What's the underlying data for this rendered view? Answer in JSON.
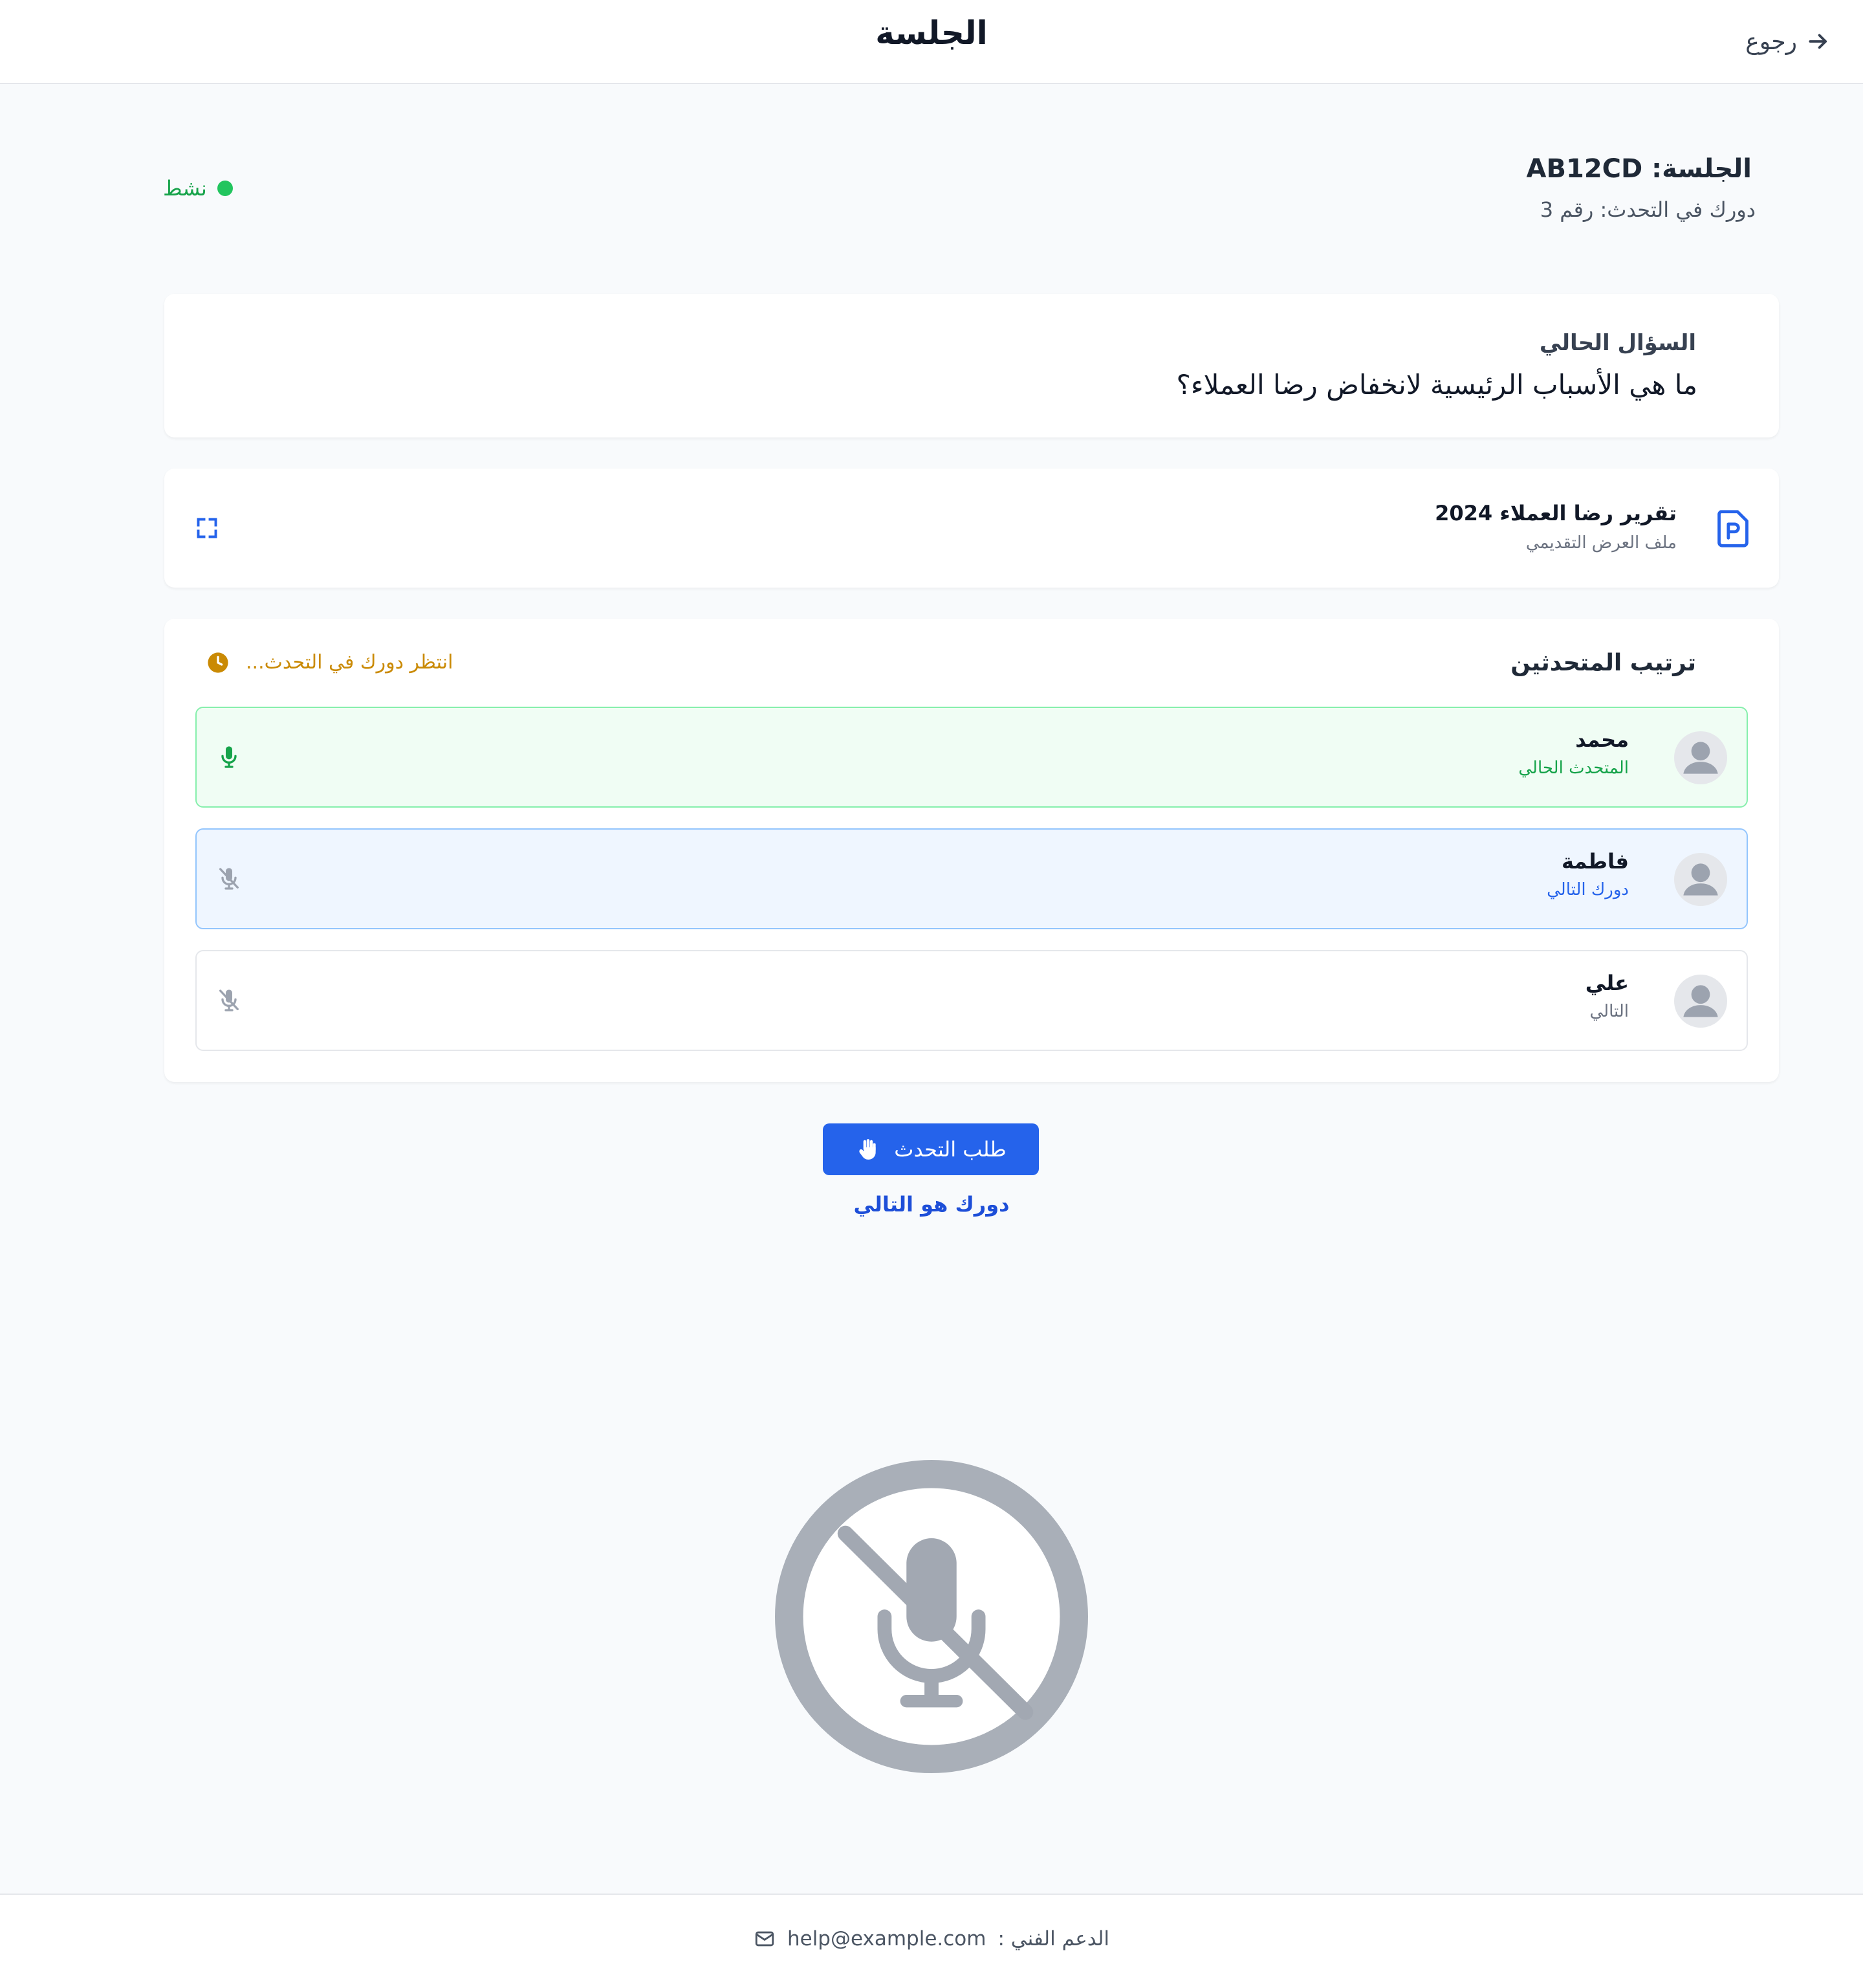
{
  "header": {
    "title": "الجلسة",
    "back_label": "رجوع"
  },
  "session": {
    "title": "الجلسة: AB12CD",
    "turn_info": "دورك في التحدث: رقم 3",
    "status_label": "نشط"
  },
  "question": {
    "label": "السؤال الحالي",
    "text": "ما هي الأسباب الرئيسية لانخفاض رضا العملاء؟"
  },
  "presentation": {
    "name": "تقرير رضا العملاء 2024",
    "type_label": "ملف العرض التقديمي"
  },
  "queue": {
    "title": "ترتيب المتحدثين",
    "wait_status": "انتظر دورك في التحدث...",
    "speakers": [
      {
        "name": "محمد",
        "status": "المتحدث الحالي"
      },
      {
        "name": "فاطمة",
        "status": "دورك التالي"
      },
      {
        "name": "علي",
        "status": "التالي"
      }
    ]
  },
  "actions": {
    "request_label": "طلب التحدث",
    "next_note": "دورك هو التالي"
  },
  "footer": {
    "support_label": "الدعم الفني :",
    "support_email": "help@example.com"
  },
  "colors": {
    "primary": "#2563eb",
    "active_green": "#16a34a",
    "waiting_amber": "#ca8a04",
    "muted_gray": "#9ca3af"
  }
}
